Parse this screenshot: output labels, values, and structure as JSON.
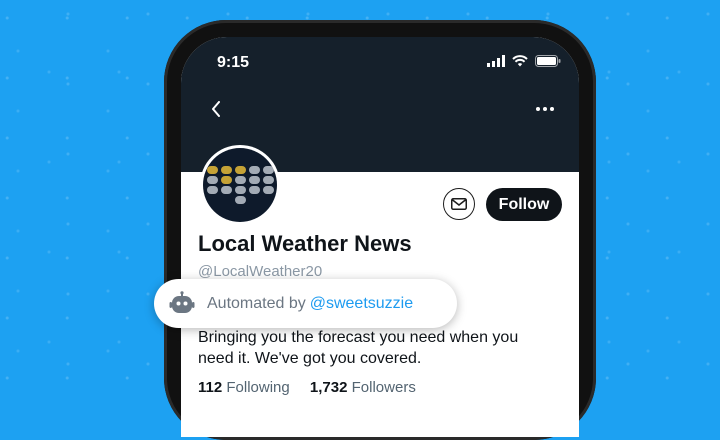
{
  "status_bar": {
    "time": "9:15"
  },
  "profile": {
    "display_name": "Local Weather News",
    "handle": "@LocalWeather20",
    "bio": "Bringing you the forecast you need when you need it.  We've got you covered.",
    "following_count": "112",
    "following_label": "Following",
    "followers_count": "1,732",
    "followers_label": "Followers",
    "follow_label": "Follow"
  },
  "automated": {
    "prefix": "Automated by",
    "account": "@sweetsuzzie"
  },
  "icons": [
    "back-arrow-icon",
    "more-icon",
    "mail-icon",
    "robot-icon",
    "signal-icon",
    "wifi-icon",
    "battery-icon"
  ],
  "colors": {
    "background": "#1da1f2",
    "banner": "#15202b",
    "link": "#1d9bf0",
    "follow_button": "#0f1419"
  }
}
